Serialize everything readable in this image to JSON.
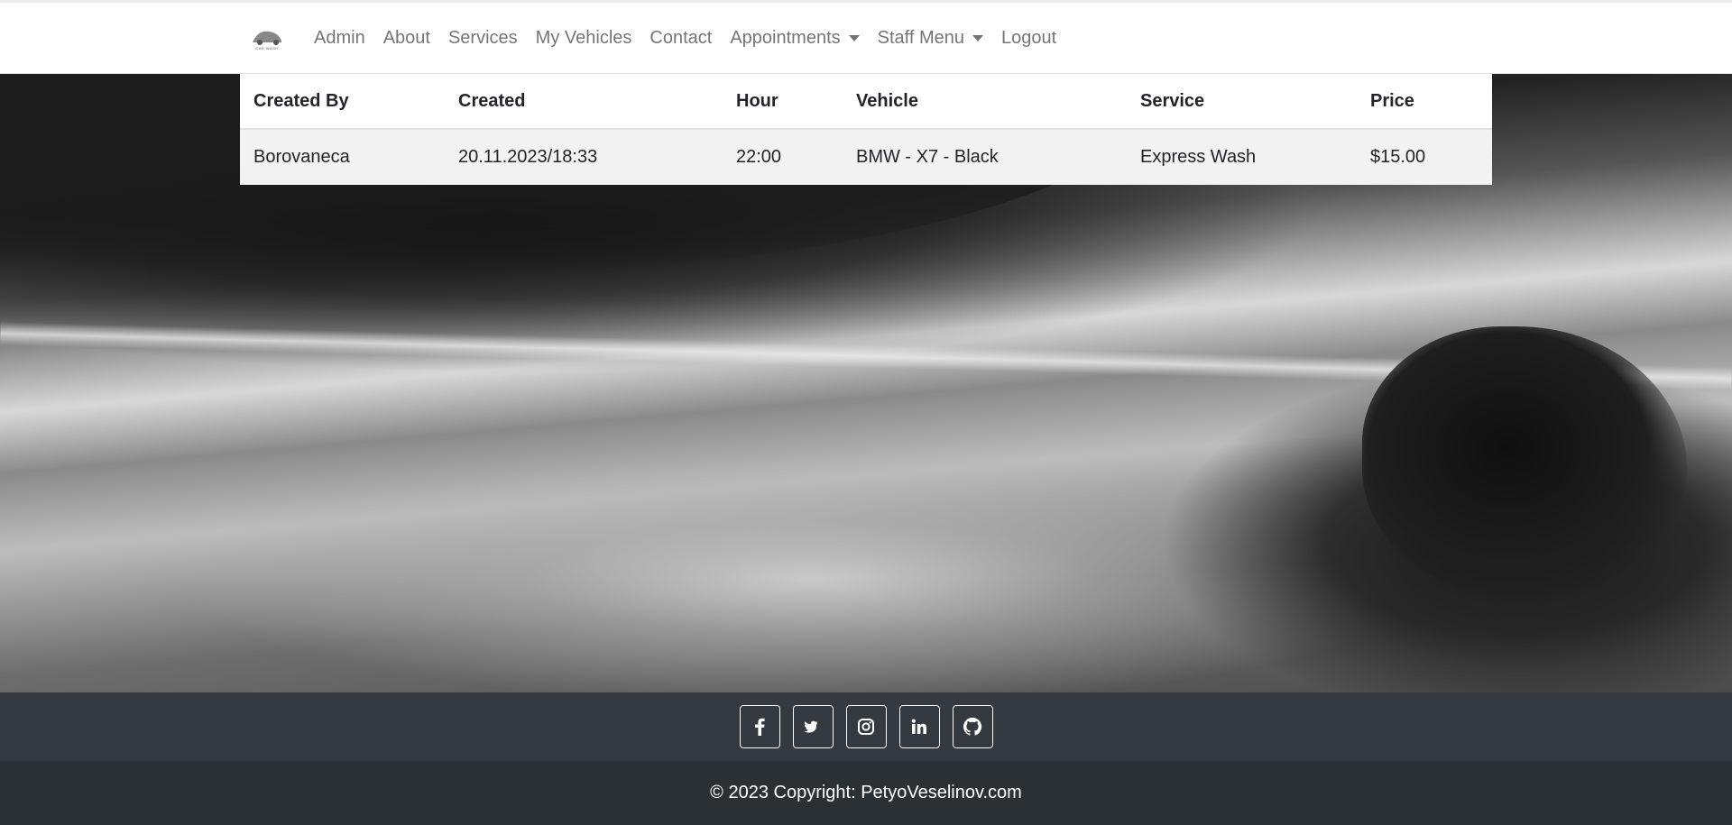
{
  "navbar": {
    "logo_text": "CAR WASH",
    "links": [
      {
        "label": "Admin"
      },
      {
        "label": "About"
      },
      {
        "label": "Services"
      },
      {
        "label": "My Vehicles"
      },
      {
        "label": "Contact"
      },
      {
        "label": "Appointments",
        "dropdown": true
      },
      {
        "label": "Staff Menu",
        "dropdown": true
      },
      {
        "label": "Logout"
      }
    ]
  },
  "table": {
    "headers": [
      "Created By",
      "Created",
      "Hour",
      "Vehicle",
      "Service",
      "Price"
    ],
    "rows": [
      [
        "Borovaneca",
        "20.11.2023/18:33",
        "22:00",
        "BMW - X7 - Black",
        "Express Wash",
        "$15.00"
      ]
    ]
  },
  "footer": {
    "social": [
      {
        "icon": "facebook-icon"
      },
      {
        "icon": "twitter-icon"
      },
      {
        "icon": "instagram-icon"
      },
      {
        "icon": "linkedin-icon"
      },
      {
        "icon": "github-icon"
      }
    ],
    "copyright": "© 2023 Copyright: PetyoVeselinov.com"
  },
  "colors": {
    "footer_top": "#343a40",
    "footer_bottom": "#2b3035",
    "row_bg": "#f2f2f2",
    "nav_link": "rgba(0,0,0,0.55)"
  }
}
